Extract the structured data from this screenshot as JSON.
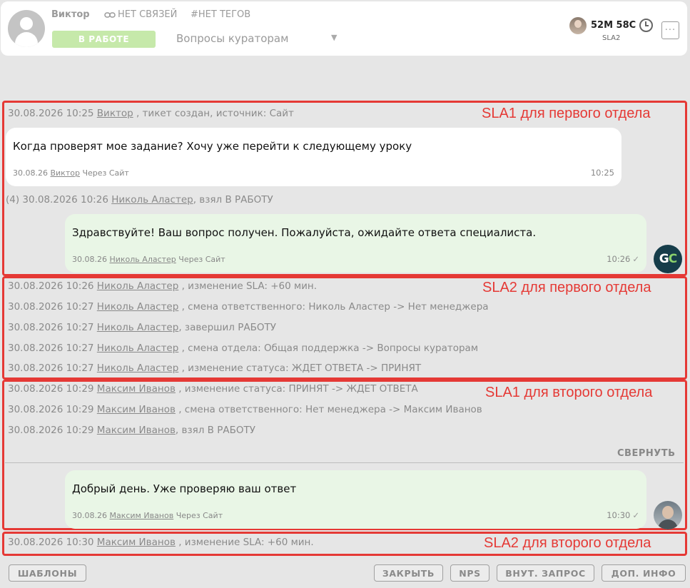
{
  "header": {
    "client_name": "Виктор",
    "links": "НЕТ СВЯЗЕЙ",
    "tags": "#НЕТ ТЕГОВ",
    "status": "В РАБОТЕ",
    "department": "Вопросы кураторам",
    "sla_time": "52М 58С",
    "sla_label": "SLA2",
    "more": "···"
  },
  "annotations": [
    "SLA1 для первого отдела",
    "SLA2 для первого отдела",
    "SLA1 для второго отдела",
    "SLA2 для второго отдела"
  ],
  "events": [
    {
      "time": "30.08.2026 10:25",
      "who": "Виктор",
      "text": " , тикет создан, источник: Сайт"
    },
    {
      "time": "(4) 30.08.2026 10:26",
      "who": "Николь Аластер",
      "text": ", взял В РАБОТУ"
    },
    {
      "time": "30.08.2026 10:26",
      "who": "Николь Аластер",
      "text": " , изменение SLA: +60 мин."
    },
    {
      "time": "30.08.2026 10:27",
      "who": "Николь Аластер",
      "text": " , смена ответственного: Николь Аластер -> Нет менеджера"
    },
    {
      "time": "30.08.2026 10:27",
      "who": "Николь Аластер",
      "text": ", завершил РАБОТУ"
    },
    {
      "time": "30.08.2026 10:27",
      "who": "Николь Аластер",
      "text": " , смена отдела: Общая поддержка -> Вопросы кураторам"
    },
    {
      "time": "30.08.2026 10:27",
      "who": "Николь Аластер",
      "text": " , изменение статуса: ЖДЕТ ОТВЕТА -> ПРИНЯТ"
    },
    {
      "time": "30.08.2026 10:29",
      "who": "Максим Иванов",
      "text": " , изменение статуса: ПРИНЯТ -> ЖДЕТ ОТВЕТА"
    },
    {
      "time": "30.08.2026 10:29",
      "who": "Максим Иванов",
      "text": " , смена ответственного: Нет менеджера -> Максим Иванов"
    },
    {
      "time": "30.08.2026 10:29",
      "who": "Максим Иванов",
      "text": ", взял В РАБОТУ"
    },
    {
      "time": "30.08.2026 10:30",
      "who": "Максим Иванов",
      "text": " , изменение SLA: +60 мин."
    }
  ],
  "messages": [
    {
      "text": "Когда проверят мое задание? Хочу уже перейти к следующему уроку",
      "date": "30.08.26",
      "who": "Виктор",
      "via": "Через Сайт",
      "time": "10:25",
      "check": ""
    },
    {
      "text": "Здравствуйте! Ваш вопрос получен. Пожалуйста, ожидайте ответа специалиста.",
      "date": "30.08.26",
      "who": "Николь Аластер",
      "via": "Через Сайт",
      "time": "10:26",
      "check": "✓"
    },
    {
      "text": "Добрый день. Уже проверяю ваш ответ",
      "date": "30.08.26",
      "who": "Максим Иванов",
      "via": "Через Сайт",
      "time": "10:30",
      "check": "✓"
    }
  ],
  "gc_avatar": {
    "g": "G",
    "c": "C"
  },
  "collapse_label": "СВЕРНУТЬ",
  "footer": {
    "templates": "ШАБЛОНЫ",
    "close": "ЗАКРЫТЬ",
    "nps": "NPS",
    "internal": "ВНУТ. ЗАПРОС",
    "more_info": "ДОП. ИНФО"
  }
}
